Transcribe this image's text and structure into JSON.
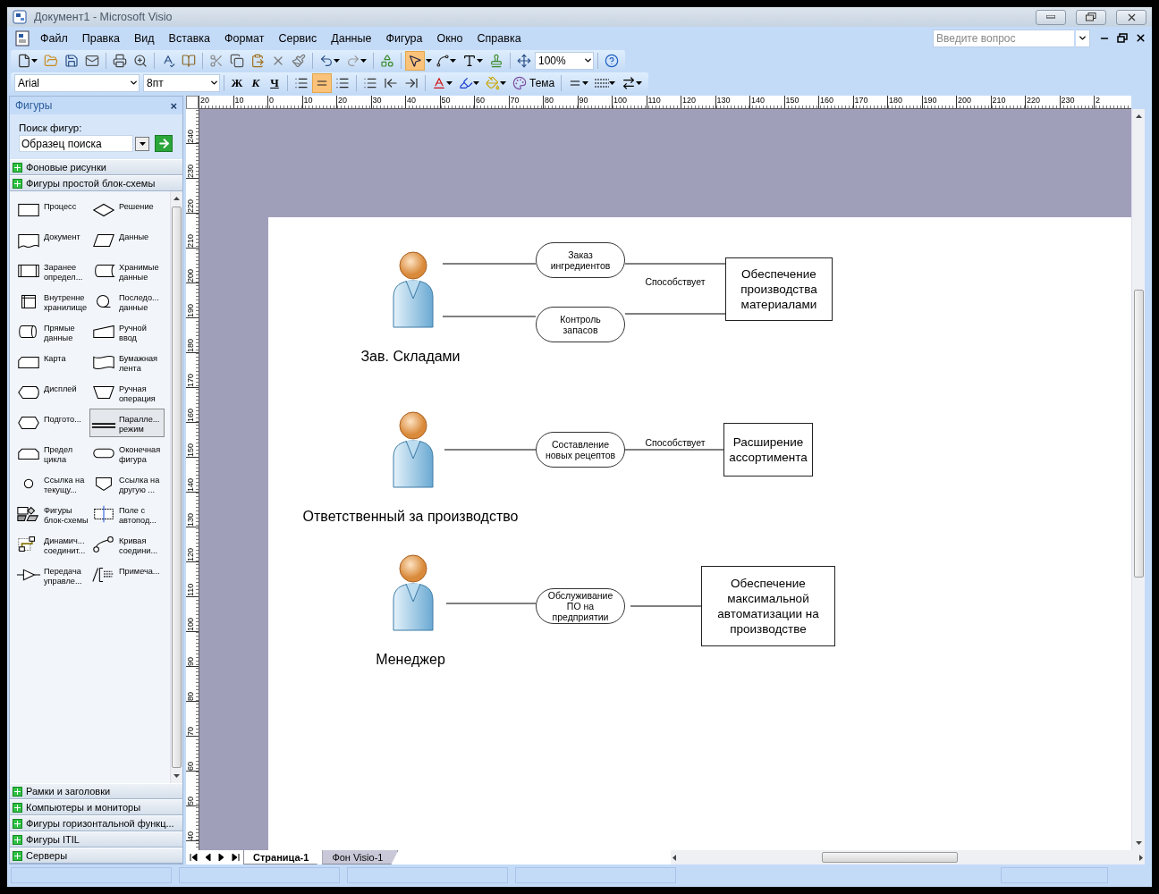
{
  "window": {
    "title": "Документ1 - Microsoft Visio"
  },
  "menu": [
    "Файл",
    "Правка",
    "Вид",
    "Вставка",
    "Формат",
    "Сервис",
    "Данные",
    "Фигура",
    "Окно",
    "Справка"
  ],
  "help_search": {
    "placeholder": "Введите вопрос"
  },
  "standard_toolbar": {
    "pointer_tool": {
      "selected": true
    },
    "zoom": "100%"
  },
  "format_toolbar": {
    "font": "Arial",
    "size": "8пт",
    "bold": "Ж",
    "italic": "К",
    "underline": "Ч",
    "align": [
      {
        "selected": false
      },
      {
        "selected": true
      },
      {
        "selected": false
      }
    ],
    "theme": "Тема"
  },
  "shapes_panel": {
    "title": "Фигуры",
    "close": "×",
    "search_label": "Поиск фигур:",
    "search_value": "Образец поиска",
    "top_categories": [
      {
        "label": "Фоновые рисунки"
      },
      {
        "label": "Фигуры простой блок-схемы"
      }
    ],
    "shapes": [
      {
        "label": "Процесс",
        "selected": false
      },
      {
        "label": "Решение",
        "selected": false
      },
      {
        "label": "Документ",
        "selected": false
      },
      {
        "label": "Данные",
        "selected": false
      },
      {
        "label": "Заранее\nопредел...",
        "selected": false
      },
      {
        "label": "Хранимые\nданные",
        "selected": false
      },
      {
        "label": "Внутренне\nхранилище",
        "selected": false
      },
      {
        "label": "Последо...\nданные",
        "selected": false
      },
      {
        "label": "Прямые\nданные",
        "selected": false
      },
      {
        "label": "Ручной\nввод",
        "selected": false
      },
      {
        "label": "Карта",
        "selected": false
      },
      {
        "label": "Бумажная\nлента",
        "selected": false
      },
      {
        "label": "Дисплей",
        "selected": false
      },
      {
        "label": "Ручная\nоперация",
        "selected": false
      },
      {
        "label": "Подгото...",
        "selected": false
      },
      {
        "label": "Паралле...\nрежим",
        "selected": true
      },
      {
        "label": "Предел\nцикла",
        "selected": false
      },
      {
        "label": "Оконечная\nфигура",
        "selected": false
      },
      {
        "label": "Ссылка на\nтекущу...",
        "selected": false
      },
      {
        "label": "Ссылка на\nдругую ...",
        "selected": false
      },
      {
        "label": "Фигуры\nблок-схемы",
        "selected": false
      },
      {
        "label": "Поле с\nавтопод...",
        "selected": false
      },
      {
        "label": "Динамич...\nсоединит...",
        "selected": false
      },
      {
        "label": "Кривая\nсоедини...",
        "selected": false
      },
      {
        "label": "Передача\nуправле...",
        "selected": false
      },
      {
        "label": "Примеча...",
        "selected": false
      }
    ],
    "bottom_categories": [
      {
        "label": "Рамки и заголовки"
      },
      {
        "label": "Компьютеры и мониторы"
      },
      {
        "label": "Фигуры горизонтальной функц..."
      },
      {
        "label": "Фигуры ITIL"
      },
      {
        "label": "Серверы"
      }
    ]
  },
  "rulers": {
    "horizontal": [
      "20",
      "10",
      "0",
      "10",
      "20",
      "30",
      "40",
      "50",
      "60",
      "70",
      "80",
      "90",
      "100",
      "110",
      "120",
      "130",
      "140",
      "150",
      "160",
      "170",
      "180",
      "190",
      "200",
      "210",
      "220",
      "230",
      "2"
    ],
    "vertical": [
      "240",
      "230",
      "220",
      "210",
      "200",
      "190",
      "180",
      "170",
      "160",
      "150",
      "140",
      "130",
      "120",
      "110",
      "100",
      "90",
      "80",
      "70",
      "60",
      "50",
      "40"
    ]
  },
  "diagram": {
    "groups": [
      {
        "role": "Зав. Складами",
        "tasks": [
          "Заказ ингредиентов",
          "Контроль запасов"
        ],
        "connector_label": "Способствует",
        "goal": "Обеспечение производства материалами"
      },
      {
        "role": "Ответственный за производство",
        "tasks": [
          "Составление новых рецептов"
        ],
        "connector_label": "Способствует",
        "goal": "Расширение ассортимента"
      },
      {
        "role": "Менеджер",
        "tasks": [
          "Обслуживание ПО на предприятии"
        ],
        "goal": "Обеспечение максимальной автоматизации на производстве"
      }
    ]
  },
  "page_tabs": [
    {
      "label": "Страница-1",
      "selected": true
    },
    {
      "label": "Фон Visio-1",
      "selected": false
    }
  ]
}
